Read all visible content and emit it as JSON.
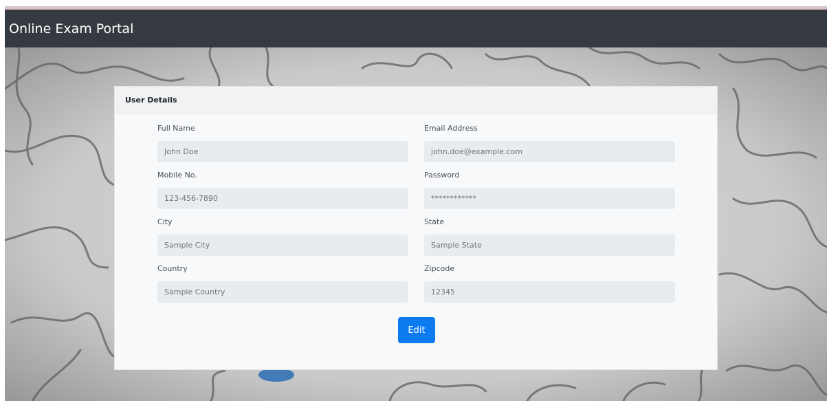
{
  "navbar": {
    "brand": "Online Exam Portal"
  },
  "card": {
    "title": "User Details",
    "fields": [
      {
        "label": "Full Name",
        "value": "John Doe"
      },
      {
        "label": "Email Address",
        "value": "john.doe@example.com"
      },
      {
        "label": "Mobile No.",
        "value": "123-456-7890"
      },
      {
        "label": "Password",
        "value": "************"
      },
      {
        "label": "City",
        "value": "Sample City"
      },
      {
        "label": "State",
        "value": "Sample State"
      },
      {
        "label": "Country",
        "value": "Sample Country"
      },
      {
        "label": "Zipcode",
        "value": "12345"
      }
    ],
    "edit_label": "Edit"
  },
  "colors": {
    "navbar": "#343a40",
    "primary_button": "#0d7bf0",
    "input_background": "#e9ecef",
    "card_background": "#f8f9fa"
  },
  "background": {
    "description_icon": "jigsaw-puzzle-background"
  }
}
